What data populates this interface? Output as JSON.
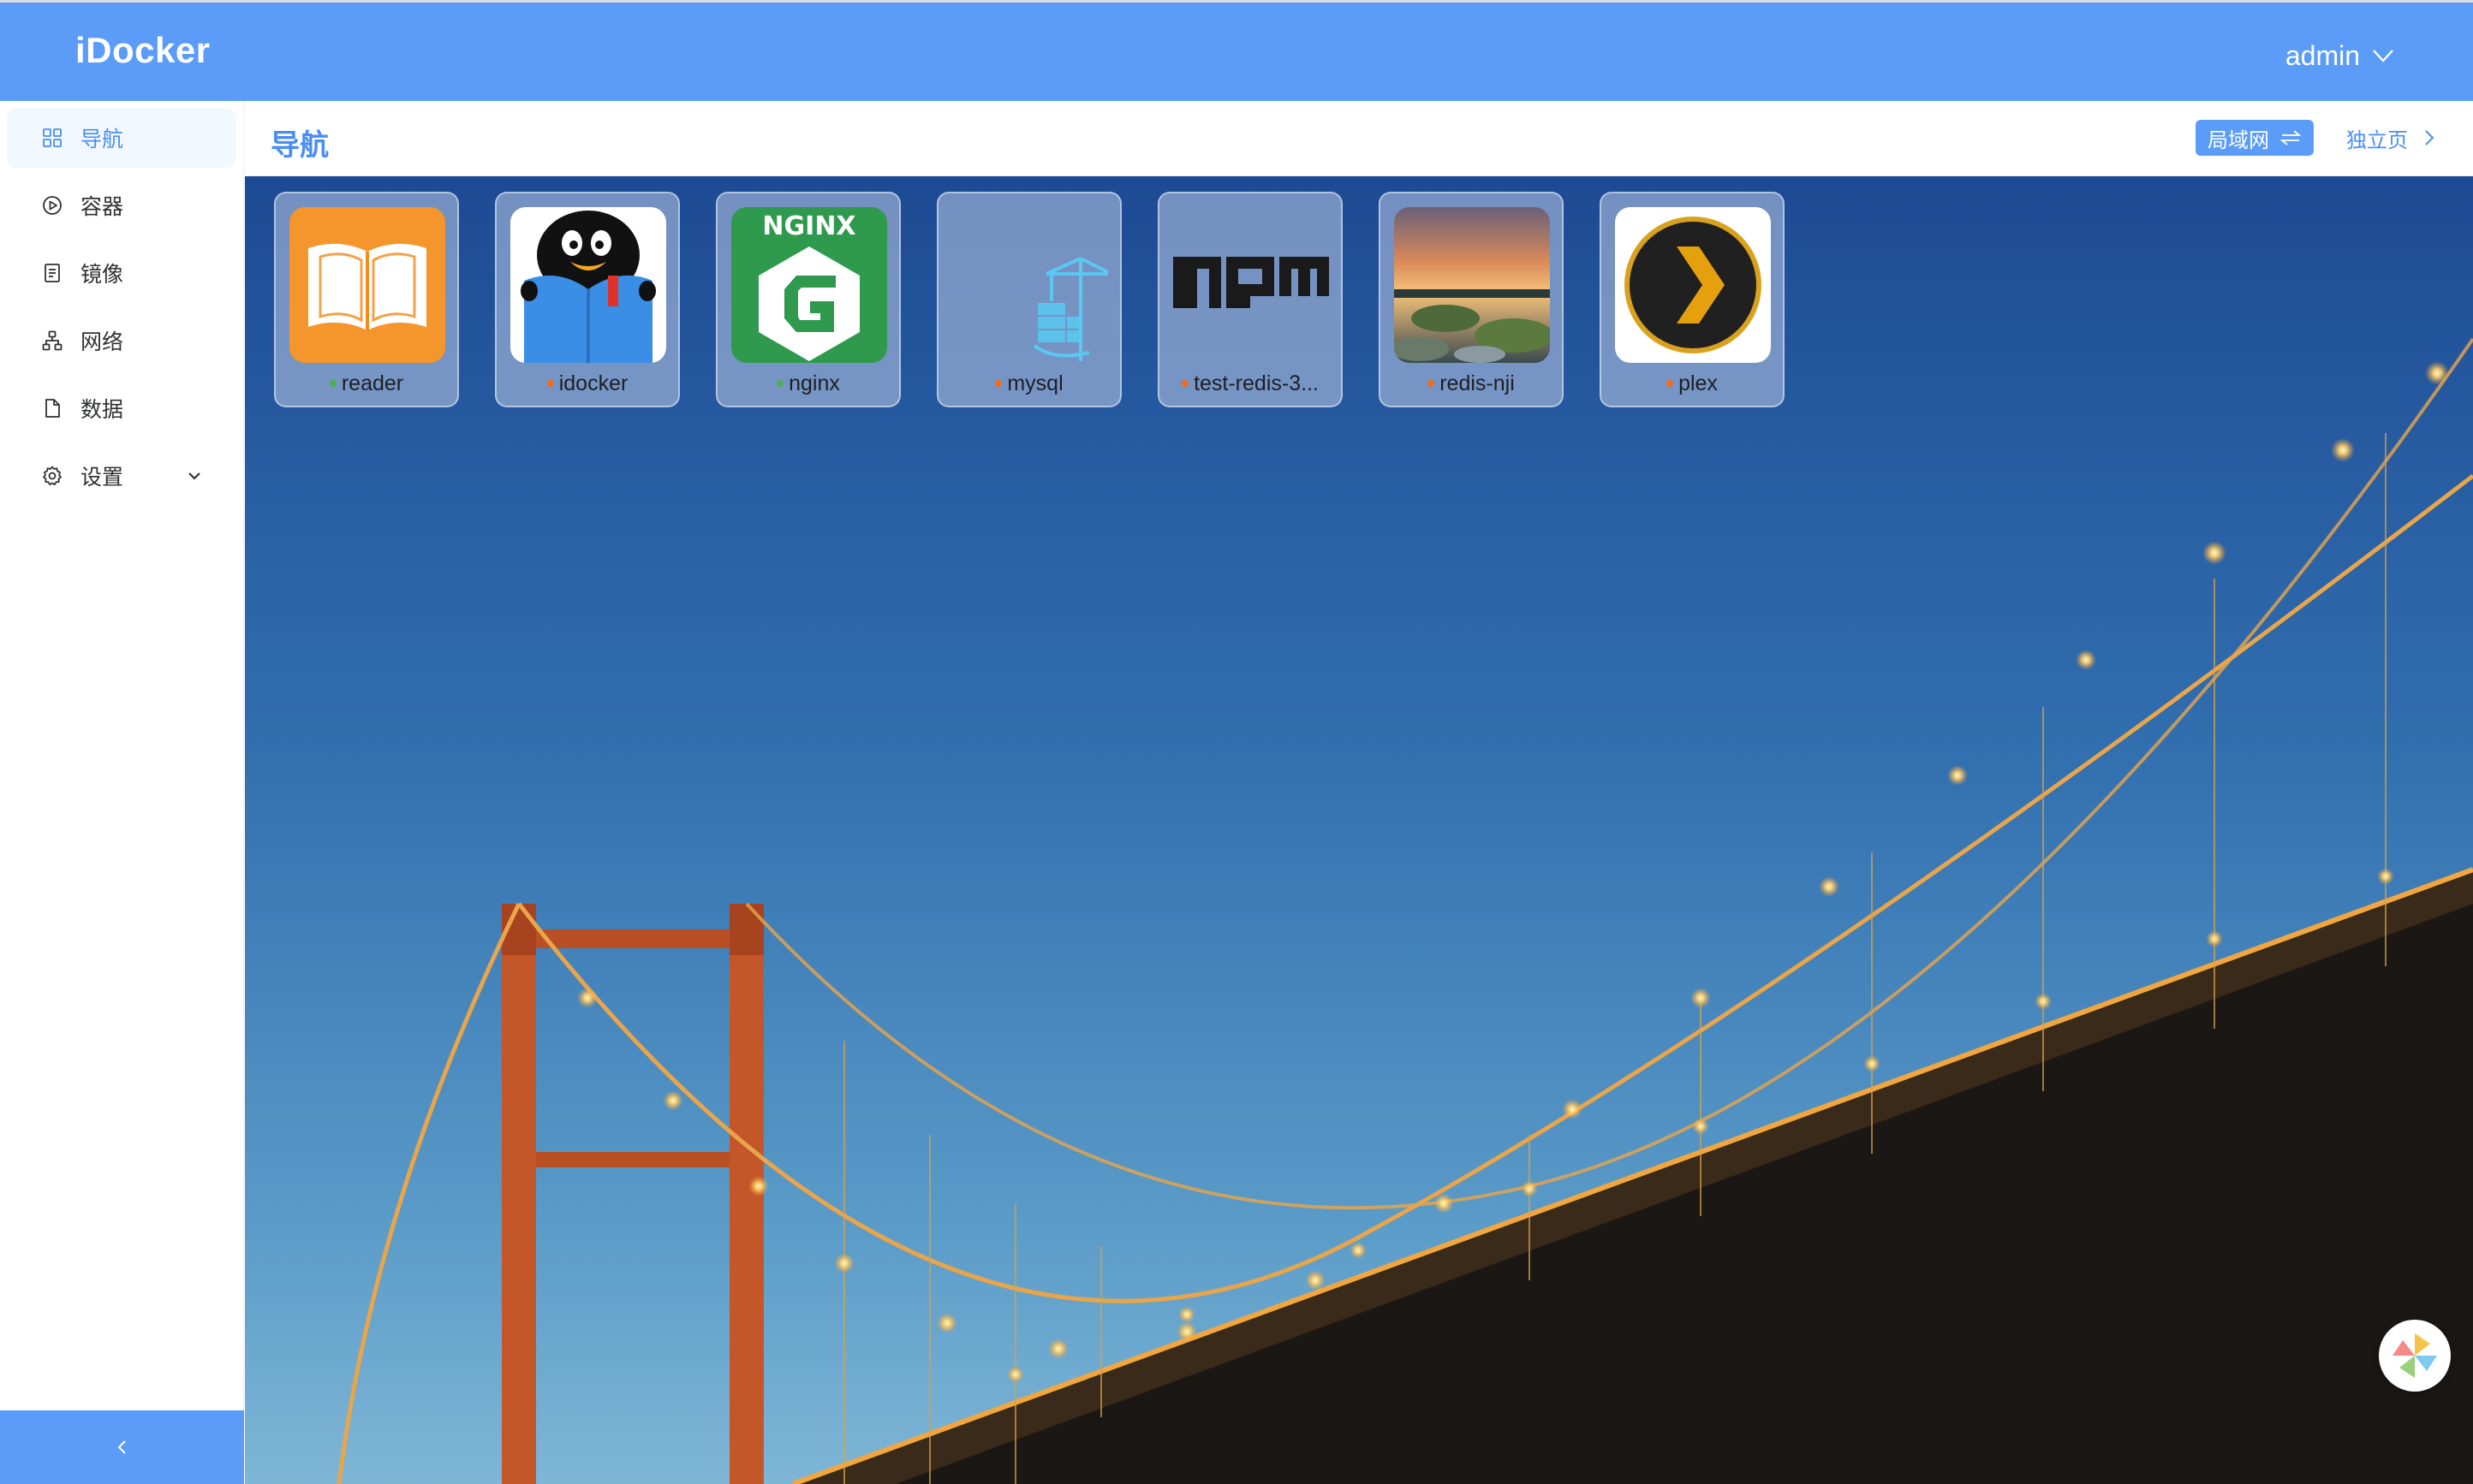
{
  "header": {
    "brand": "iDocker",
    "user": "admin"
  },
  "sidebar": {
    "items": [
      {
        "label": "导航",
        "icon": "grid-icon",
        "active": true
      },
      {
        "label": "容器",
        "icon": "play-circle-icon"
      },
      {
        "label": "镜像",
        "icon": "document-list-icon"
      },
      {
        "label": "网络",
        "icon": "network-icon"
      },
      {
        "label": "数据",
        "icon": "file-icon"
      },
      {
        "label": "设置",
        "icon": "gear-icon",
        "has_submenu": true
      }
    ],
    "collapse_icon": "chevron-left-icon"
  },
  "page": {
    "title": "导航",
    "lan_button": "局域网",
    "lan_icon": "swap-arrows-icon",
    "standalone_link": "独立页"
  },
  "apps": [
    {
      "name": "reader",
      "status": "running",
      "status_color": "#4caf50",
      "icon": "book-icon"
    },
    {
      "name": "idocker",
      "status": "stopped",
      "status_color": "#f26b1d",
      "icon": "penguin-reading-icon"
    },
    {
      "name": "nginx",
      "status": "running",
      "status_color": "#4caf50",
      "icon": "nginx-logo-icon"
    },
    {
      "name": "mysql",
      "status": "stopped",
      "status_color": "#f26b1d",
      "icon": "container-crane-icon"
    },
    {
      "name": "test-redis-3...",
      "status": "stopped",
      "status_color": "#f26b1d",
      "icon": "npm-logo-icon"
    },
    {
      "name": "redis-nji",
      "status": "stopped",
      "status_color": "#f26b1d",
      "icon": "sunset-photo-icon"
    },
    {
      "name": "plex",
      "status": "stopped",
      "status_color": "#f26b1d",
      "icon": "plex-logo-icon"
    }
  ],
  "colors": {
    "primary": "#5a9cf8",
    "accent_text": "#4a8ef5",
    "running": "#4caf50",
    "stopped": "#f26b1d"
  },
  "float_button_icon": "pinwheel-icon"
}
